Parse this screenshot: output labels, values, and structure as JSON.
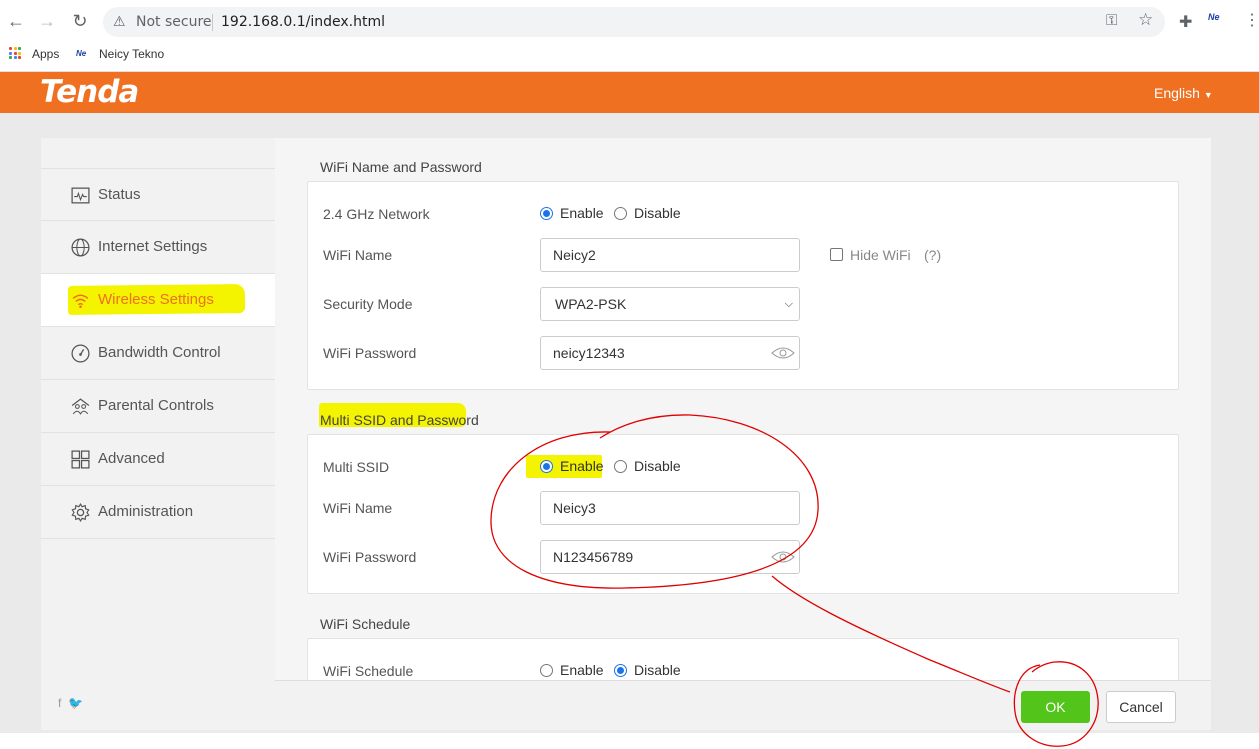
{
  "browser": {
    "security_label": "Not secure",
    "url": "192.168.0.1/index.html",
    "bookmarks": [
      "Apps",
      "Neicy Tekno"
    ]
  },
  "header": {
    "logo": "Tenda",
    "language": "English"
  },
  "sidebar": {
    "items": [
      {
        "label": "Status",
        "icon": "status-icon"
      },
      {
        "label": "Internet Settings",
        "icon": "globe-icon"
      },
      {
        "label": "Wireless Settings",
        "icon": "wifi-icon",
        "active": true
      },
      {
        "label": "Bandwidth Control",
        "icon": "gauge-icon"
      },
      {
        "label": "Parental Controls",
        "icon": "family-icon"
      },
      {
        "label": "Advanced",
        "icon": "grid-icon"
      },
      {
        "label": "Administration",
        "icon": "gear-icon"
      }
    ]
  },
  "wifi": {
    "title": "WiFi Name and Password",
    "network_label": "2.4 GHz Network",
    "enable": "Enable",
    "disable": "Disable",
    "name_label": "WiFi Name",
    "name_value": "Neicy2",
    "hide_label": "Hide WiFi",
    "help": "(?)",
    "security_label": "Security Mode",
    "security_value": "WPA2-PSK",
    "password_label": "WiFi Password",
    "password_value": "neicy12343",
    "network_enabled": true
  },
  "multi": {
    "title": "Multi SSID and Password",
    "ssid_label": "Multi SSID",
    "enable": "Enable",
    "disable": "Disable",
    "name_label": "WiFi Name",
    "name_value": "Neicy3",
    "password_label": "WiFi Password",
    "password_value": "N123456789",
    "enabled": true
  },
  "schedule": {
    "title": "WiFi Schedule",
    "label": "WiFi Schedule",
    "enable": "Enable",
    "disable": "Disable",
    "enabled": false
  },
  "footer": {
    "ok": "OK",
    "cancel": "Cancel"
  },
  "colors": {
    "brand": "#ee7020",
    "ok": "#52c41a",
    "highlight": "#f4f400",
    "annotation": "#e00000"
  }
}
